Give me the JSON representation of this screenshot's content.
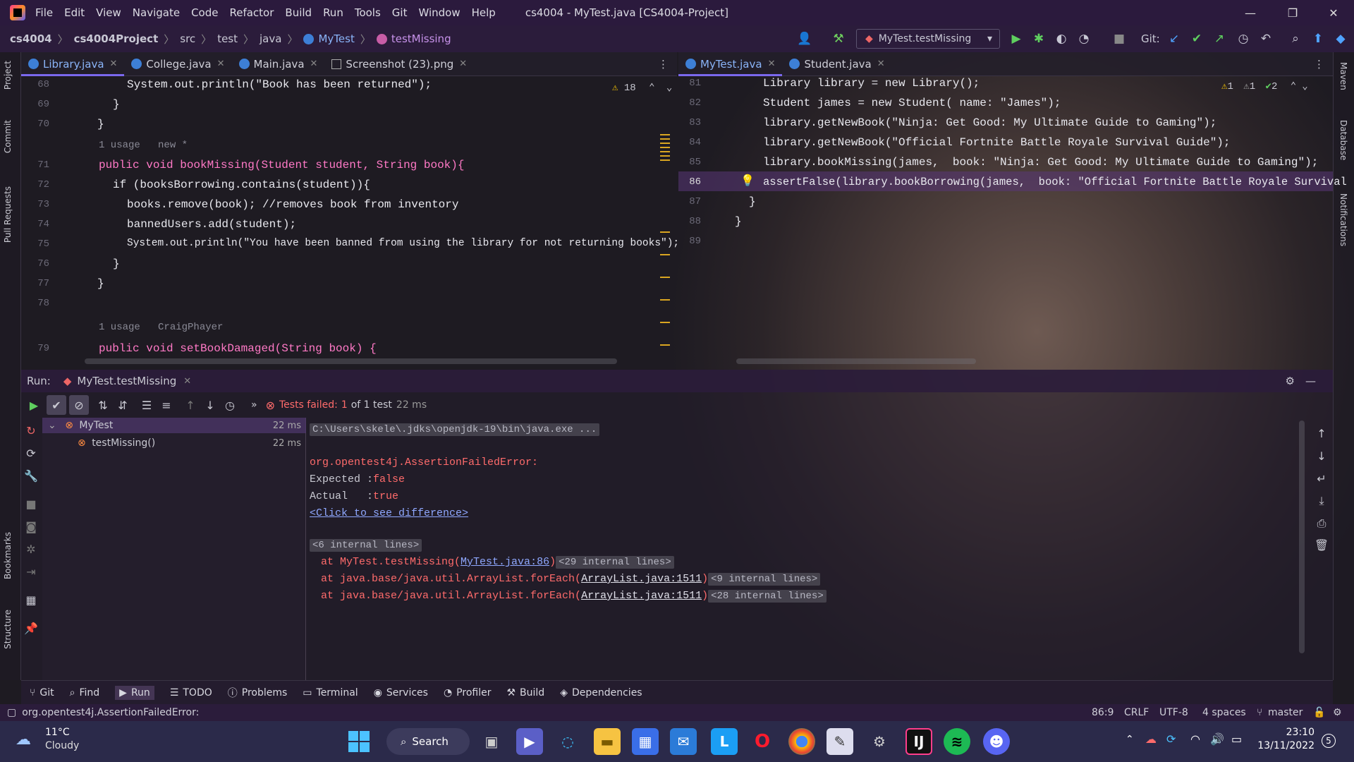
{
  "window": {
    "title": "cs4004 - MyTest.java [CS4004-Project]",
    "menu": [
      "File",
      "Edit",
      "View",
      "Navigate",
      "Code",
      "Refactor",
      "Build",
      "Run",
      "Tools",
      "Git",
      "Window",
      "Help"
    ]
  },
  "breadcrumb": [
    "cs4004",
    "cs4004Project",
    "src",
    "test",
    "java",
    "MyTest",
    "testMissing"
  ],
  "toolbar": {
    "run_config": "MyTest.testMissing",
    "git_label": "Git:"
  },
  "left_editor": {
    "tabs": [
      "Library.java",
      "College.java",
      "Main.java",
      "Screenshot (23).png"
    ],
    "warnings": "18",
    "lines": [
      {
        "n": "68",
        "code": "System.out.println(\"Book has been returned\");"
      },
      {
        "n": "69",
        "code": "}"
      },
      {
        "n": "70",
        "code": "}"
      },
      {
        "n": "",
        "code": "1 usage   new *"
      },
      {
        "n": "71",
        "code": "public void bookMissing(Student student, String book){"
      },
      {
        "n": "72",
        "code": "if (booksBorrowing.contains(student)){"
      },
      {
        "n": "73",
        "code": "books.remove(book); //removes book from inventory"
      },
      {
        "n": "74",
        "code": "bannedUsers.add(student);"
      },
      {
        "n": "75",
        "code": "System.out.println(\"You have been banned from using the library for not returning books\");"
      },
      {
        "n": "76",
        "code": "}"
      },
      {
        "n": "77",
        "code": "}"
      },
      {
        "n": "78",
        "code": ""
      },
      {
        "n": "",
        "code": "1 usage   CraigPhayer"
      },
      {
        "n": "79",
        "code": "public void setBookDamaged(String book) {"
      }
    ]
  },
  "right_editor": {
    "tabs": [
      "MyTest.java",
      "Student.java"
    ],
    "inspections": {
      "warn1": "1",
      "warn2": "1",
      "ok": "2"
    },
    "lines": [
      {
        "n": "81",
        "code": "Library library = new Library();"
      },
      {
        "n": "82",
        "code": "Student james = new Student( name: \"James\");"
      },
      {
        "n": "83",
        "code": "library.getNewBook(\"Ninja: Get Good: My Ultimate Guide to Gaming\");"
      },
      {
        "n": "84",
        "code": "library.getNewBook(\"Official Fortnite Battle Royale Survival Guide\");"
      },
      {
        "n": "85",
        "code": "library.bookMissing(james,  book: \"Ninja: Get Good: My Ultimate Guide to Gaming\");"
      },
      {
        "n": "86",
        "code": "assertFalse(library.bookBorrowing(james,  book: \"Official Fortnite Battle Royale Survival Guide\"));"
      },
      {
        "n": "87",
        "code": "}"
      },
      {
        "n": "88",
        "code": "}"
      },
      {
        "n": "89",
        "code": ""
      }
    ]
  },
  "run": {
    "label": "Run:",
    "tab": "MyTest.testMissing",
    "summary_prefix": "Tests failed:",
    "summary_count": "1",
    "summary_suffix": "of 1 test",
    "summary_time": "22 ms",
    "tree": [
      {
        "name": "MyTest",
        "time": "22 ms"
      },
      {
        "name": "testMissing()",
        "time": "22 ms"
      }
    ],
    "console": {
      "cmd": "C:\\Users\\skele\\.jdks\\openjdk-19\\bin\\java.exe ...",
      "error": "org.opentest4j.AssertionFailedError:",
      "expected_label": "Expected :",
      "expected_value": "false",
      "actual_label": "Actual   :",
      "actual_value": "true",
      "diff_link": "<Click to see difference>",
      "internal1": "<6 internal lines>",
      "trace": [
        {
          "prefix": "at MyTest.testMissing(",
          "link": "MyTest.java:86",
          "suffix": ")",
          "internal": "<29 internal lines>"
        },
        {
          "prefix": "at java.base/java.util.ArrayList.forEach(",
          "link": "ArrayList.java:1511",
          "suffix": ")",
          "internal": "<9 internal lines>"
        },
        {
          "prefix": "at java.base/java.util.ArrayList.forEach(",
          "link": "ArrayList.java:1511",
          "suffix": ")",
          "internal": "<28 internal lines>"
        }
      ]
    }
  },
  "tool_tabs": [
    {
      "icon": "git-icon",
      "label": "Git"
    },
    {
      "icon": "find-icon",
      "label": "Find"
    },
    {
      "icon": "run-icon",
      "label": "Run"
    },
    {
      "icon": "todo-icon",
      "label": "TODO"
    },
    {
      "icon": "problems-icon",
      "label": "Problems"
    },
    {
      "icon": "terminal-icon",
      "label": "Terminal"
    },
    {
      "icon": "services-icon",
      "label": "Services"
    },
    {
      "icon": "profiler-icon",
      "label": "Profiler"
    },
    {
      "icon": "build-icon",
      "label": "Build"
    },
    {
      "icon": "dependencies-icon",
      "label": "Dependencies"
    }
  ],
  "side_tabs": {
    "left": [
      "Project",
      "Commit",
      "Pull Requests",
      "Bookmarks",
      "Structure"
    ],
    "right": [
      "Maven",
      "Database",
      "Notifications"
    ]
  },
  "status": {
    "message": "org.opentest4j.AssertionFailedError:",
    "position": "86:9",
    "line_sep": "CRLF",
    "encoding": "UTF-8",
    "indent": "4 spaces",
    "branch": "master"
  },
  "taskbar": {
    "temp": "11°C",
    "weather": "Cloudy",
    "search": "Search",
    "time": "23:10",
    "date": "13/11/2022",
    "notif": "5"
  }
}
